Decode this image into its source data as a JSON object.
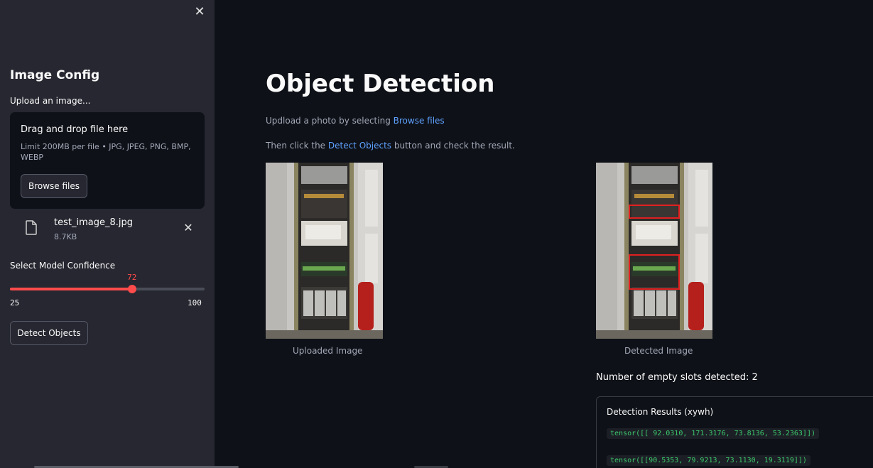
{
  "sidebar": {
    "close_label": "✕",
    "title": "Image Config",
    "upload_label": "Upload an image...",
    "dropzone": {
      "title": "Drag and drop file here",
      "subtitle": "Limit 200MB per file • JPG, JPEG, PNG, BMP, WEBP",
      "browse_label": "Browse files"
    },
    "file": {
      "icon": "file-icon",
      "name": "test_image_8.jpg",
      "size": "8.7KB",
      "remove_label": "✕"
    },
    "slider": {
      "label": "Select Model Confidence",
      "min": 25,
      "max": 100,
      "value": 72,
      "min_text": "25",
      "max_text": "100",
      "value_text": "72",
      "color": "#ff4b4b"
    },
    "detect_label": "Detect Objects"
  },
  "main": {
    "title": "Object Detection",
    "line1_prefix": "Updload a photo by selecting ",
    "line1_link": "Browse files",
    "line2_prefix": "Then click the ",
    "line2_link": "Detect Objects",
    "line2_suffix": " button and check the result.",
    "uploaded_caption": "Uploaded Image",
    "detected_caption": "Detected Image",
    "count_text": "Number of empty slots detected: 2",
    "results_title": "Detection Results (xywh)",
    "results": [
      "tensor([[ 92.0310, 171.3176, 73.8136, 53.2363]])",
      "tensor([[90.5353, 79.9213, 73.1130, 19.3119]])"
    ]
  },
  "colors": {
    "background": "#0e1117",
    "sidebar": "#262730",
    "accent": "#ff4b4b",
    "link": "#5ea1ff",
    "code_text": "#3cc96b"
  }
}
